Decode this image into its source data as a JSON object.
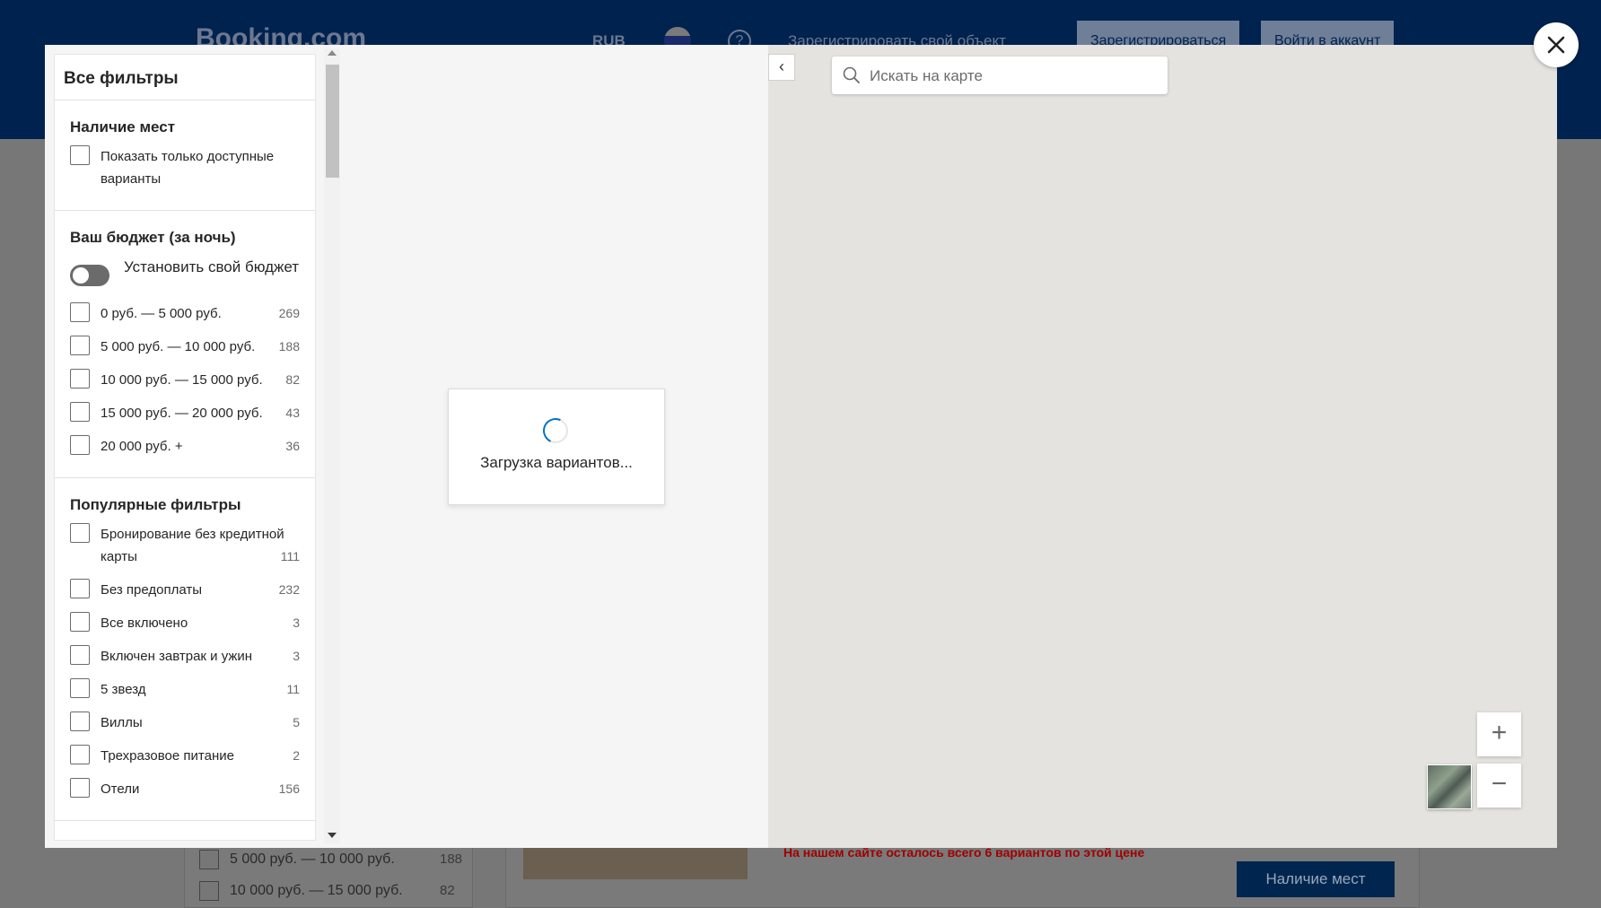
{
  "background": {
    "logo": "Booking.com",
    "currency": "RUB",
    "list_property": "Зарегистрировать свой объект",
    "register_button": "Зарегистрироваться",
    "signin_button": "Войти в аккаунт",
    "sidebar_row1": {
      "label": "5 000 руб. — 10 000 руб.",
      "count": "188"
    },
    "sidebar_row2": {
      "label": "10 000 руб. — 15 000 руб.",
      "count": "82"
    },
    "card_message": "На нашем сайте осталось всего 6 вариантов по этой цене",
    "card_button": "Наличие мест"
  },
  "filters": {
    "title": "Все фильтры",
    "availability": {
      "title": "Наличие мест",
      "options": [
        {
          "label": "Показать только доступные варианты",
          "count": ""
        }
      ]
    },
    "budget": {
      "title": "Ваш бюджет (за ночь)",
      "toggle_label": "Установить свой бюджет",
      "toggle_on": false,
      "options": [
        {
          "label": "0 руб. — 5 000 руб.",
          "count": "269"
        },
        {
          "label": "5 000 руб. — 10 000 руб.",
          "count": "188"
        },
        {
          "label": "10 000 руб. — 15 000 руб.",
          "count": "82"
        },
        {
          "label": "15 000 руб. — 20 000 руб.",
          "count": "43"
        },
        {
          "label": "20 000 руб. +",
          "count": "36"
        }
      ]
    },
    "popular": {
      "title": "Популярные фильтры",
      "options": [
        {
          "label": "Бронирование без кредитной карты",
          "count": "111"
        },
        {
          "label": "Без предоплаты",
          "count": "232"
        },
        {
          "label": "Все включено",
          "count": "3"
        },
        {
          "label": "Включен завтрак и ужин",
          "count": "3"
        },
        {
          "label": "5 звезд",
          "count": "11"
        },
        {
          "label": "Виллы",
          "count": "5"
        },
        {
          "label": "Трехразовое питание",
          "count": "2"
        },
        {
          "label": "Отели",
          "count": "156"
        }
      ]
    }
  },
  "list": {
    "loading_text": "Загрузка вариантов..."
  },
  "map": {
    "search_placeholder": "Искать на карте",
    "search_value": "",
    "collapse_label": "‹",
    "zoom_in": "+",
    "zoom_out": "−"
  },
  "colors": {
    "header_blue": "#003580",
    "accent_blue": "#0071c2",
    "alert_red": "#cc0000",
    "map_background": "#e5e3df"
  }
}
